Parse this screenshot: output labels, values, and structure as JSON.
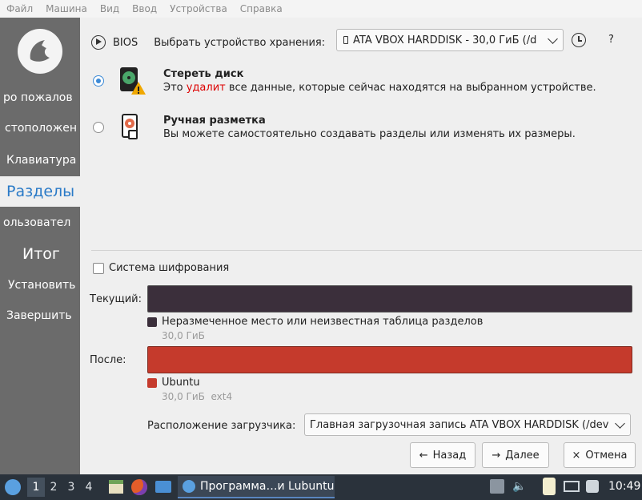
{
  "menubar": {
    "items": [
      "Файл",
      "Машина",
      "Вид",
      "Ввод",
      "Устройства",
      "Справка"
    ]
  },
  "sidebar": {
    "items": [
      {
        "label": "ро пожалов",
        "state": "normal"
      },
      {
        "label": "стоположен",
        "state": "normal"
      },
      {
        "label": "Клавиатура",
        "state": "normal"
      },
      {
        "label": "Разделы",
        "state": "active"
      },
      {
        "label": "ользовател",
        "state": "normal"
      },
      {
        "label": "Итог",
        "state": "big"
      },
      {
        "label": "Установить",
        "state": "normal"
      },
      {
        "label": "Завершить",
        "state": "normal"
      }
    ]
  },
  "storage": {
    "bios_label": "BIOS",
    "select_label": "Выбрать устройство хранения:",
    "device_value": "ATA VBOX HARDDISK - 30,0 ГиБ (/d",
    "help_label": "?"
  },
  "options": {
    "erase": {
      "title": "Стереть диск",
      "desc_before": "Это ",
      "desc_warn": "удалит",
      "desc_after": " все данные, которые сейчас находятся на выбранном устройстве.",
      "checked": true
    },
    "manual": {
      "title": "Ручная разметка",
      "desc": "Вы можете самостоятельно создавать разделы или изменять их размеры.",
      "checked": false
    }
  },
  "encryption": {
    "label": "Система шифрования",
    "checked": false
  },
  "current": {
    "label": "Текущий:",
    "color": "#3b2f3b",
    "legend": "Неразмеченное место или неизвестная таблица разделов",
    "size": "30,0 ГиБ"
  },
  "after": {
    "label": "После:",
    "color": "#c53a2c",
    "legend": "Ubuntu",
    "size": "30,0 ГиБ  ext4"
  },
  "bootloader": {
    "label": "Расположение загрузчика:",
    "value": "Главная загрузочная запись ATA VBOX HARDDISK (/dev"
  },
  "buttons": {
    "back": "Назад",
    "next": "Далее",
    "cancel": "Отмена"
  },
  "taskbar": {
    "workspaces": [
      "1",
      "2",
      "3",
      "4"
    ],
    "active_workspace": "1",
    "task_title": "Программа…и Lubuntu",
    "clock": "10:49"
  },
  "colors": {
    "accent": "#2a7ac7",
    "sidebar": "#6b6b6b",
    "taskbar": "#2a323b",
    "danger": "#dd0000"
  }
}
